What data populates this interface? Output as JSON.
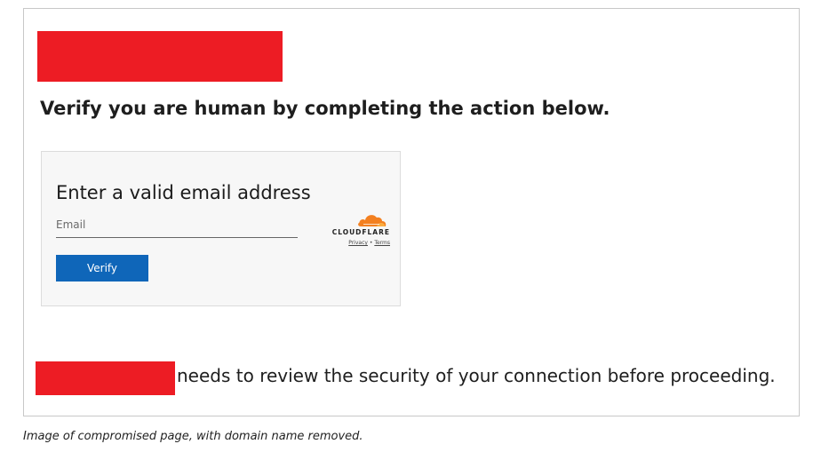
{
  "page": {
    "headline": "Verify you are human by completing the action below.",
    "security_notice": "needs to review the security of your connection before proceeding.",
    "caption": "Image of compromised page, with domain name removed.",
    "redaction_color": "#ed1c24"
  },
  "form": {
    "title": "Enter a valid email address",
    "email_placeholder": "Email",
    "verify_label": "Verify",
    "button_color": "#0f66b9"
  },
  "cloudflare": {
    "wordmark": "CLOUDFLARE",
    "privacy_label": "Privacy",
    "separator": "•",
    "terms_label": "Terms",
    "logo_color": "#f38020",
    "icon": "cloud-icon"
  }
}
